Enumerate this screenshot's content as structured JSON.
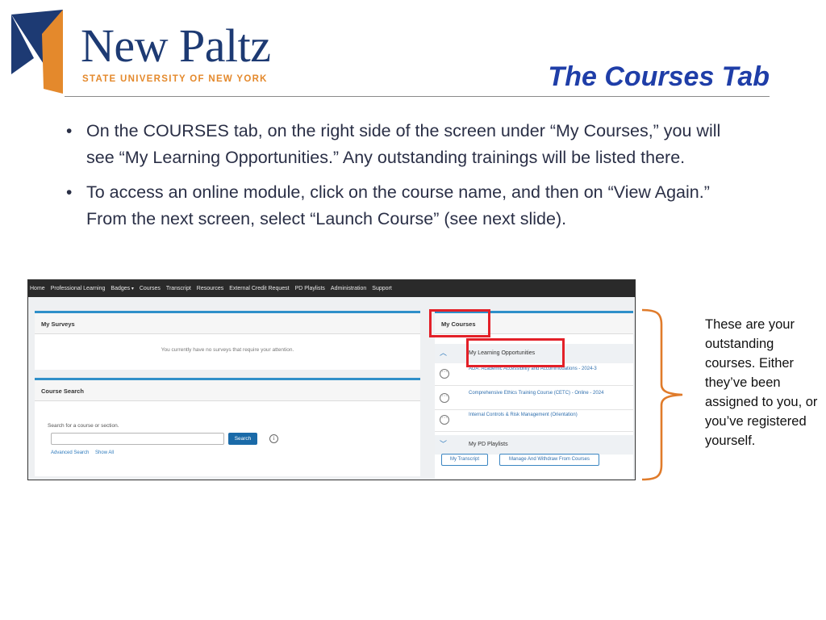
{
  "logo": {
    "name": "New Paltz",
    "subtitle": "STATE UNIVERSITY OF NEW YORK",
    "colors": {
      "blue": "#1d3a73",
      "orange": "#e4892c"
    }
  },
  "slide": {
    "title": "The Courses Tab",
    "bullets": [
      "On the COURSES tab, on the right side of the screen under “My Courses,” you will see “My Learning Opportunities.” Any outstanding trainings will be listed there.",
      "To access an online module, click on the course name, and then on “View Again.” From the next screen, select “Launch Course” (see next slide)."
    ],
    "note": "These are your outstanding courses. Either they’ve been assigned to you, or you’ve registered yourself."
  },
  "screenshot": {
    "nav": [
      "Home",
      "Professional Learning",
      "Badges",
      "Courses",
      "Transcript",
      "Resources",
      "External Credit Request",
      "PD Playlists",
      "Administration",
      "Support"
    ],
    "surveys": {
      "title": "My Surveys",
      "empty_text": "You currently have no surveys that require your attention."
    },
    "course_search": {
      "title": "Course Search",
      "label": "Search for a course or section.",
      "button": "Search",
      "info_icon": "i",
      "advanced": "Advanced Search",
      "show_all": "Show All"
    },
    "my_courses": {
      "title": "My Courses",
      "learning_section": "My Learning Opportunities",
      "courses": [
        "ADA: Academic Accessibility and Accommodations - 2024-3",
        "Comprehensive Ethics Training Course (CETC) - Online - 2024",
        "Internal Controls & Risk Management (Orientation)"
      ],
      "playlists_section": "My PD Playlists",
      "buttons": {
        "transcript": "My Transcript",
        "manage": "Manage And Withdraw From Courses"
      }
    },
    "icons": {
      "collapse": "chevron-up-icon",
      "expand": "chevron-down-icon",
      "options": "ellipsis-circle-icon"
    }
  },
  "colors": {
    "title": "#1f3ea8",
    "highlight": "#e32028",
    "brace": "#e07b2a",
    "accent": "#2f8fc9"
  }
}
